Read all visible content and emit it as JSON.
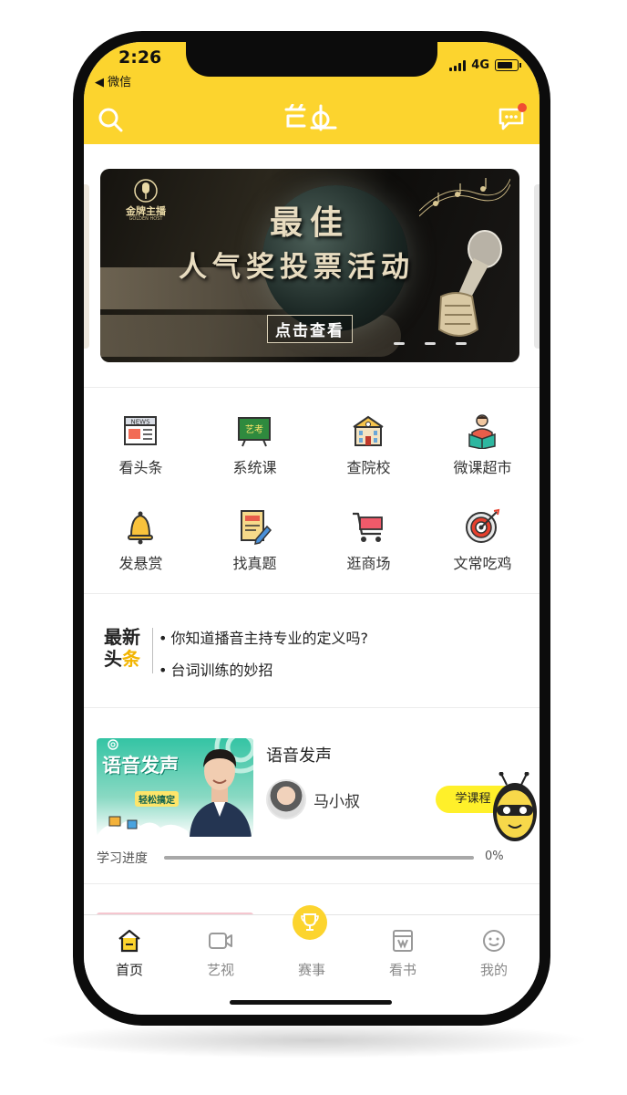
{
  "status_bar": {
    "time": "2:26",
    "back_app": "◀ 微信",
    "network": "4G"
  },
  "header": {
    "logo_icon": "yikao-logo-icon",
    "search_icon": "search-icon",
    "message_icon": "message-icon",
    "accent_color": "#fcd42e",
    "badge_color": "#f04d32"
  },
  "banner": {
    "brand": "金牌主播",
    "brand_sub": "GOLDEN HOST",
    "title_line1": "最佳",
    "title_line2": "人气奖投票活动",
    "button_label": "点击查看",
    "slide_count": 3
  },
  "grid": {
    "items": [
      {
        "label": "看头条",
        "icon": "news-icon"
      },
      {
        "label": "系统课",
        "icon": "chalkboard-icon"
      },
      {
        "label": "查院校",
        "icon": "school-building-icon"
      },
      {
        "label": "微课超市",
        "icon": "reading-person-icon"
      },
      {
        "label": "发悬赏",
        "icon": "bell-icon"
      },
      {
        "label": "找真题",
        "icon": "exam-paper-icon"
      },
      {
        "label": "逛商场",
        "icon": "shopping-cart-icon"
      },
      {
        "label": "文常吃鸡",
        "icon": "target-icon"
      }
    ],
    "chalkboard_text": "艺考",
    "news_text": "NEWS"
  },
  "headlines": {
    "logo_line1": "最新",
    "logo_line2a": "头",
    "logo_line2b": "条",
    "items": [
      "你知道播音主持专业的定义吗?",
      "台词训练的妙招"
    ]
  },
  "course": {
    "thumb_title": "语音发声",
    "thumb_badge": "轻松搞定",
    "title": "语音发声",
    "teacher": "马小叔",
    "button_label": "学课程",
    "progress_label": "学习进度",
    "progress_value": 0,
    "progress_text": "0%"
  },
  "tabbar": {
    "tabs": [
      {
        "label": "首页",
        "icon": "home-icon",
        "active": true
      },
      {
        "label": "艺视",
        "icon": "video-camera-icon",
        "active": false
      },
      {
        "label": "赛事",
        "icon": "trophy-icon",
        "active": false
      },
      {
        "label": "看书",
        "icon": "book-icon",
        "active": false
      },
      {
        "label": "我的",
        "icon": "profile-face-icon",
        "active": false
      }
    ]
  }
}
